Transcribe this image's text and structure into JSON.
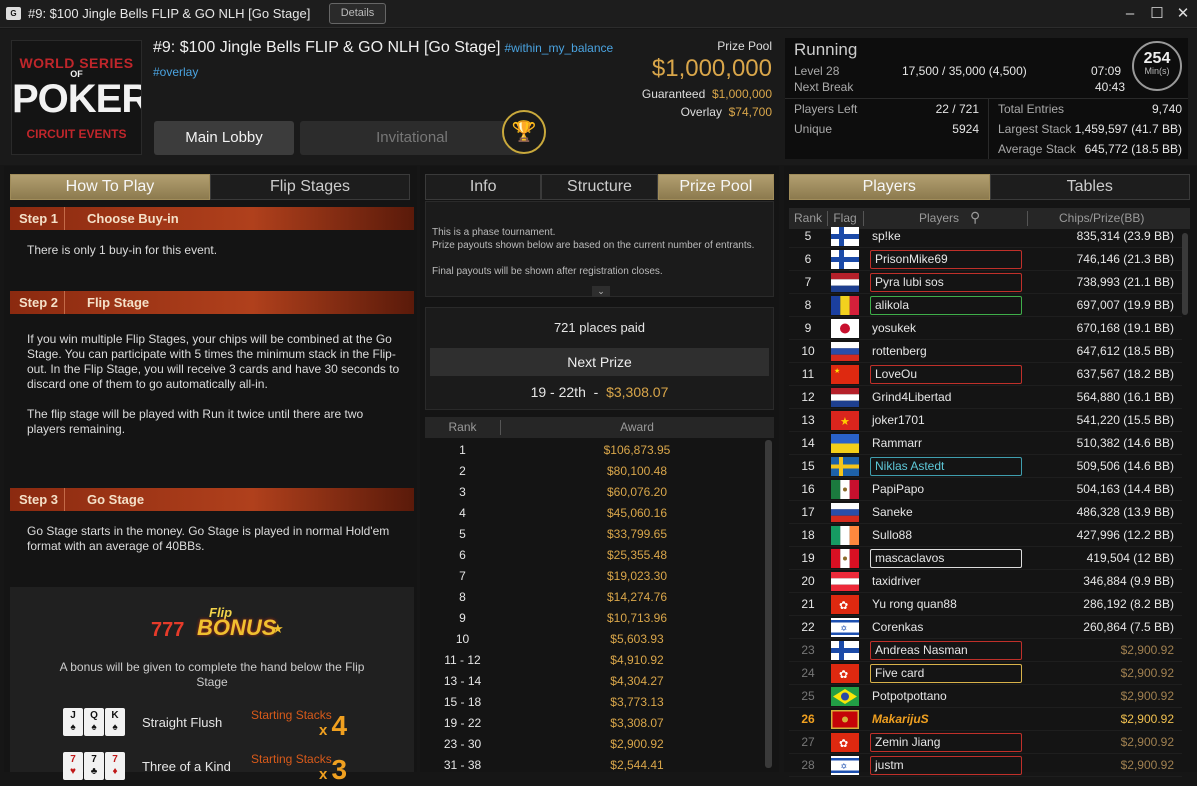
{
  "window": {
    "title": "#9: $100 Jingle Bells FLIP & GO NLH [Go Stage]",
    "details": "Details",
    "app_icon": "G",
    "minimize": "–",
    "maximize": "☐",
    "close": "✕"
  },
  "logo": {
    "line1": "WORLD SERIES",
    "line2": "OF",
    "line3": "POKER",
    "line4": "CIRCUIT EVENTS"
  },
  "tournament": {
    "name": "#9: $100 Jingle Bells FLIP & GO NLH [Go Stage]",
    "tag1": "#within_my_balance",
    "tag2": "#overlay",
    "main_lobby": "Main Lobby",
    "invitational": "Invitational"
  },
  "prize": {
    "label": "Prize Pool",
    "amount": "$1,000,000",
    "guaranteed_label": "Guaranteed",
    "guaranteed": "$1,000,000",
    "overlay_label": "Overlay",
    "overlay": "$74,700"
  },
  "status": {
    "state": "Running",
    "level_label": "Level 28",
    "blinds": "17,500 / 35,000 (4,500)",
    "level_time": "07:09",
    "next_break_label": "Next Break",
    "next_break": "40:43",
    "mins": "254",
    "mins_label": "Min(s)",
    "players_left_label": "Players Left",
    "players_left": "22 / 721",
    "unique_label": "Unique",
    "unique": "5924",
    "total_entries_label": "Total Entries",
    "total_entries": "9,740",
    "largest_label": "Largest Stack",
    "largest": "1,459,597 (41.7 BB)",
    "average_label": "Average Stack",
    "average": "645,772 (18.5 BB)"
  },
  "left": {
    "tabs": [
      "How To Play",
      "Flip Stages"
    ],
    "steps": [
      {
        "num": "Step 1",
        "name": "Choose Buy-in",
        "text": "There is only 1 buy-in for this event."
      },
      {
        "num": "Step 2",
        "name": "Flip Stage",
        "text": "If you win multiple Flip Stages, your chips will be combined at the Go Stage. You can participate with 5 times the minimum stack in the Flip-out. In the Flip Stage, you will receive 3 cards and have 30 seconds to discard one of them to go automatically all-in.",
        "text2": "The flip stage will be played with Run it twice until there are two players remaining."
      },
      {
        "num": "Step 3",
        "name": "Go Stage",
        "text": "Go Stage starts in the money. Go Stage is played in normal Hold'em format with an average of 40BBs."
      }
    ],
    "bonus": {
      "logo_flip": "Flip",
      "logo_bonus": "BONUS",
      "logo_seven": "777",
      "text": "A bonus will be given to complete the hand below the Flip Stage",
      "hands": [
        {
          "cards": [
            "J",
            "Q",
            "K"
          ],
          "name": "Straight Flush",
          "label": "Starting Stacks",
          "mult": "4"
        },
        {
          "cards": [
            "7",
            "7",
            "7"
          ],
          "name": "Three of a Kind",
          "label": "Starting Stacks",
          "mult": "3"
        }
      ]
    }
  },
  "mid": {
    "tabs": [
      "Info",
      "Structure",
      "Prize Pool"
    ],
    "info_lines": [
      "This is a phase tournament.",
      "Prize payouts shown below are based on the current number of entrants.",
      "Final payouts will be shown after registration closes."
    ],
    "places_paid": "721 places paid",
    "next_prize_label": "Next Prize",
    "next_prize_range": "19 - 22th",
    "next_prize_amount": "$3,308.07",
    "table_head": {
      "rank": "Rank",
      "award": "Award"
    },
    "payouts": [
      [
        "1",
        "$106,873.95"
      ],
      [
        "2",
        "$80,100.48"
      ],
      [
        "3",
        "$60,076.20"
      ],
      [
        "4",
        "$45,060.16"
      ],
      [
        "5",
        "$33,799.65"
      ],
      [
        "6",
        "$25,355.48"
      ],
      [
        "7",
        "$19,023.30"
      ],
      [
        "8",
        "$14,274.76"
      ],
      [
        "9",
        "$10,713.96"
      ],
      [
        "10",
        "$5,603.93"
      ],
      [
        "11 - 12",
        "$4,910.92"
      ],
      [
        "13 - 14",
        "$4,304.27"
      ],
      [
        "15 - 18",
        "$3,773.13"
      ],
      [
        "19 - 22",
        "$3,308.07"
      ],
      [
        "23 - 30",
        "$2,900.92"
      ],
      [
        "31 - 38",
        "$2,544.41"
      ]
    ]
  },
  "right": {
    "tabs": [
      "Players",
      "Tables"
    ],
    "head": {
      "rank": "Rank",
      "flag": "Flag",
      "players": "Players",
      "chips": "Chips/Prize(BB)"
    },
    "players": [
      {
        "rank": "5",
        "flag": "fi",
        "name": "sp!ke",
        "chips": "835,314 (23.9 BB)",
        "box": ""
      },
      {
        "rank": "6",
        "flag": "fi",
        "name": "PrisonMike69",
        "chips": "746,146 (21.3 BB)",
        "box": "red"
      },
      {
        "rank": "7",
        "flag": "nl",
        "name": "Pyra lubi sos",
        "chips": "738,993 (21.1 BB)",
        "box": "red"
      },
      {
        "rank": "8",
        "flag": "ad",
        "name": "alikola",
        "chips": "697,007 (19.9 BB)",
        "box": "green"
      },
      {
        "rank": "9",
        "flag": "jp",
        "name": "yosukek",
        "chips": "670,168 (19.1 BB)",
        "box": ""
      },
      {
        "rank": "10",
        "flag": "ru",
        "name": "rottenberg",
        "chips": "647,612 (18.5 BB)",
        "box": ""
      },
      {
        "rank": "11",
        "flag": "cn",
        "name": "LoveOu",
        "chips": "637,567 (18.2 BB)",
        "box": "red"
      },
      {
        "rank": "12",
        "flag": "nl",
        "name": "Grind4Libertad",
        "chips": "564,880 (16.1 BB)",
        "box": ""
      },
      {
        "rank": "13",
        "flag": "vn",
        "name": "joker1701",
        "chips": "541,220 (15.5 BB)",
        "box": ""
      },
      {
        "rank": "14",
        "flag": "ua",
        "name": "Rammarr",
        "chips": "510,382 (14.6 BB)",
        "box": ""
      },
      {
        "rank": "15",
        "flag": "se",
        "name": "Niklas Astedt",
        "chips": "509,506 (14.6 BB)",
        "box": "teal"
      },
      {
        "rank": "16",
        "flag": "mx",
        "name": "PapiPapo",
        "chips": "504,163 (14.4 BB)",
        "box": ""
      },
      {
        "rank": "17",
        "flag": "ru",
        "name": "Saneke",
        "chips": "486,328 (13.9 BB)",
        "box": ""
      },
      {
        "rank": "18",
        "flag": "ie",
        "name": "Sullo88",
        "chips": "427,996 (12.2 BB)",
        "box": ""
      },
      {
        "rank": "19",
        "flag": "pe",
        "name": "mascaclavos",
        "chips": "419,504 (12 BB)",
        "box": "white"
      },
      {
        "rank": "20",
        "flag": "at",
        "name": "taxidriver",
        "chips": "346,884 (9.9 BB)",
        "box": ""
      },
      {
        "rank": "21",
        "flag": "hk",
        "name": "Yu rong quan88",
        "chips": "286,192 (8.2 BB)",
        "box": ""
      },
      {
        "rank": "22",
        "flag": "il",
        "name": "Corenkas",
        "chips": "260,864 (7.5 BB)",
        "box": ""
      },
      {
        "rank": "23",
        "flag": "fi",
        "name": "Andreas Nasman",
        "chips": "$2,900.92",
        "box": "red",
        "elim": true
      },
      {
        "rank": "24",
        "flag": "hk",
        "name": "Five card",
        "chips": "$2,900.92",
        "box": "yellow",
        "elim": true
      },
      {
        "rank": "25",
        "flag": "br",
        "name": "Potpotpottano",
        "chips": "$2,900.92",
        "box": "",
        "elim": true
      },
      {
        "rank": "26",
        "flag": "me",
        "name": "MakarijuS",
        "chips": "$2,900.92",
        "box": "",
        "elim": true,
        "me": true
      },
      {
        "rank": "27",
        "flag": "hk",
        "name": "Zemin Jiang",
        "chips": "$2,900.92",
        "box": "red",
        "elim": true
      },
      {
        "rank": "28",
        "flag": "il",
        "name": "justm",
        "chips": "$2,900.92",
        "box": "red",
        "elim": true
      }
    ]
  }
}
